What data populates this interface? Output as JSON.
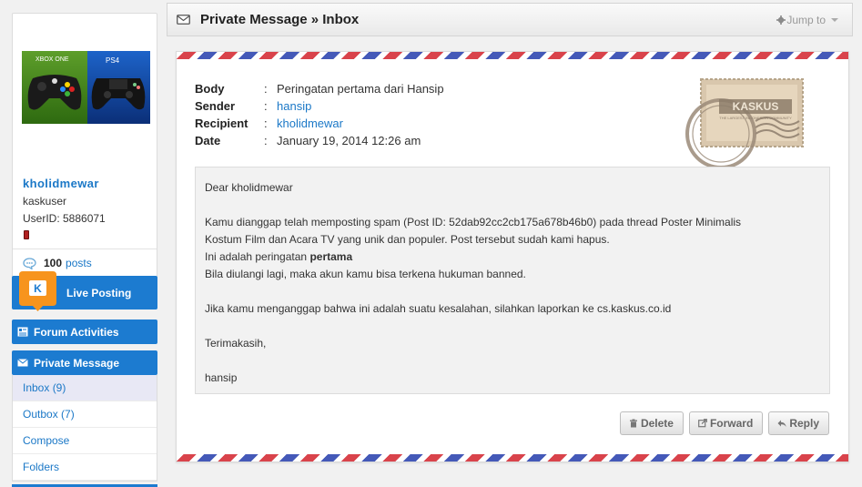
{
  "sidebar": {
    "avatar": {
      "left_text": "XBOX ONE",
      "right_text": "PS4"
    },
    "username": "kholidmewar",
    "usertitle": "kaskuser",
    "userid": "UserID: 5886071",
    "posts_count": "100",
    "posts_label": "posts",
    "live_posting": "Live Posting",
    "forum_activities": "Forum Activities",
    "private_message": "Private Message",
    "pm_items": [
      {
        "label": "Inbox (9)"
      },
      {
        "label": "Outbox (7)"
      },
      {
        "label": "Compose"
      },
      {
        "label": "Folders"
      }
    ]
  },
  "header": {
    "title": "Private Message » Inbox",
    "jump_to": "Jump to"
  },
  "message": {
    "labels": {
      "body": "Body",
      "sender": "Sender",
      "recipient": "Recipient",
      "date": "Date",
      "sep": ":"
    },
    "body_title": "Peringatan pertama dari Hansip",
    "sender": "hansip",
    "recipient": "kholidmewar",
    "date": "January 19, 2014 12:26 am",
    "stamp_text": "KASKUS",
    "stamp_sub": "THE LARGEST INDONESIAN COMMUNITY",
    "content": {
      "greeting": "Dear kholidmewar",
      "line1": "Kamu dianggap telah memposting spam (Post ID: 52dab92cc2cb175a678b46b0) pada thread Poster Minimalis",
      "line2": "Kostum Film dan Acara TV yang unik dan populer. Post tersebut sudah kami hapus.",
      "line3_pre": "Ini adalah peringatan ",
      "line3_bold": "pertama",
      "line4": "Bila diulangi lagi, maka akun kamu bisa terkena hukuman banned.",
      "line5": "Jika kamu menganggap bahwa ini adalah suatu kesalahan, silahkan laporkan ke cs.kaskus.co.id",
      "thanks": "Terimakasih,",
      "signature": "hansip"
    },
    "buttons": {
      "delete": "Delete",
      "forward": "Forward",
      "reply": "Reply"
    }
  },
  "colors": {
    "accent": "#1c7bd0",
    "link": "#1b78c7",
    "stripe_red": "#d9434b",
    "stripe_blue": "#4459b8"
  }
}
